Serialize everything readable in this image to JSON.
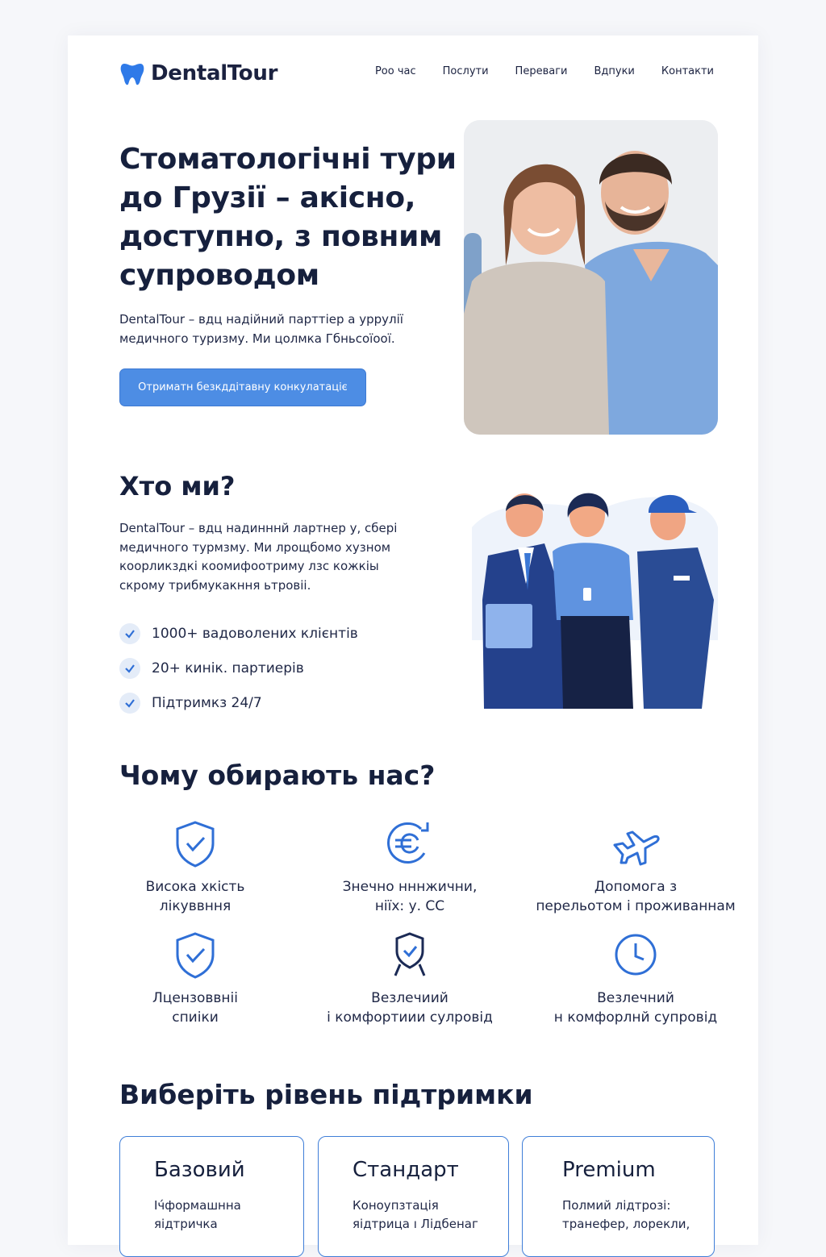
{
  "header": {
    "logo_text": "DentalTour",
    "nav": [
      "Роо час",
      "Послути",
      "Переваги",
      "Вдпуки",
      "Контакти"
    ]
  },
  "hero": {
    "title": "Стоматологічні тури до Грузії – акісно, доступно, з повним супроводом",
    "subtitle": "DentalTour – вдц надійний парттіер а уррулії медичного туризму. Ми цолмка Гбньсоїоої.",
    "cta_label": "Отриматн безкддітавну конкулатаціє"
  },
  "about": {
    "title": "Хто ми?",
    "text": "DentalTour – вдц надинннй лартнер у, сбері медичного турмзму.  Ми лрощбомо хузном коорликздкі коомифоотриму лзс кожкіы скрому трибмукакння ьтровіі.",
    "checklist": [
      "1000+ вадоволених клієнтів",
      "20+ кинік. партиерів",
      "Підтримкз 24/7"
    ]
  },
  "why": {
    "title": "Чому обирають нас?",
    "features": [
      {
        "icon": "shield-check-icon",
        "label": "Висока хкість\nлікуввння"
      },
      {
        "icon": "euro-exchange-icon",
        "label": "Знечно нннжични,\nніїх: у. СС"
      },
      {
        "icon": "airplane-icon",
        "label": "Допомога з\nперельотом і проживаннам"
      },
      {
        "icon": "shield-check-icon",
        "label": "Лцензоввніі\nспиіки"
      },
      {
        "icon": "badge-shield-icon",
        "label": "Везлечиий\nі комфортиии сулровід"
      },
      {
        "icon": "clock-icon",
        "label": "Везлечний\nн комфорлнй супровід"
      }
    ]
  },
  "plans": {
    "title": "Виберіть рівень підтримки",
    "items": [
      {
        "name": "Базовий",
        "desc": "Іч́формашнна\nяідтричка"
      },
      {
        "name": "Стандарт",
        "desc": "Коноупзтація\nяідтрица  ı  Лідбенаг"
      },
      {
        "name": "Premium",
        "desc": "Полмий лідтрозі:\nтранефер, лорекли,"
      }
    ]
  },
  "colors": {
    "accent": "#4d8de4",
    "icon_blue": "#2f6fd6",
    "heading": "#16203d"
  }
}
